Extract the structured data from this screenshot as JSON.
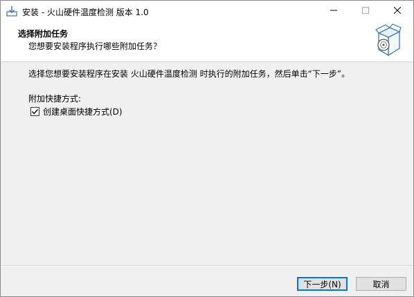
{
  "window": {
    "title": "安装 - 火山硬件温度检测 版本 1.0"
  },
  "header": {
    "title": "选择附加任务",
    "subtitle": "您想要安装程序执行哪些附加任务？"
  },
  "main": {
    "description": "选择您想要安装程序在安装 火山硬件温度检测 时执行的附加任务，然后单击“下一步”。",
    "group_label": "附加快捷方式:",
    "checkbox": {
      "label": "创建桌面快捷方式(D)",
      "checked": true
    }
  },
  "footer": {
    "next_label": "下一步(N)",
    "cancel_label": "取消"
  },
  "icons": {
    "app": "install-icon",
    "header": "box-disc-icon",
    "minimize": "minimize-icon",
    "maximize": "maximize-icon",
    "close": "close-icon"
  }
}
